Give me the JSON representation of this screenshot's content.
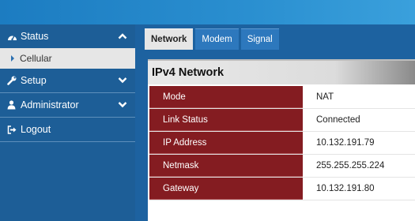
{
  "sidebar": {
    "status": "Status",
    "cellular": "Cellular",
    "setup": "Setup",
    "administrator": "Administrator",
    "logout": "Logout"
  },
  "tabs": [
    "Network",
    "Modem",
    "Signal"
  ],
  "panel": {
    "title": "IPv4 Network",
    "rows": [
      {
        "label": "Mode",
        "value": "NAT"
      },
      {
        "label": "Link Status",
        "value": "Connected"
      },
      {
        "label": "IP Address",
        "value": "10.132.191.79"
      },
      {
        "label": "Netmask",
        "value": "255.255.255.224"
      },
      {
        "label": "Gateway",
        "value": "10.132.191.80"
      }
    ]
  },
  "colors": {
    "sidebar_bg": "#1d5e97",
    "label_bg": "#841c21",
    "topbar": "#2a8fd0"
  }
}
